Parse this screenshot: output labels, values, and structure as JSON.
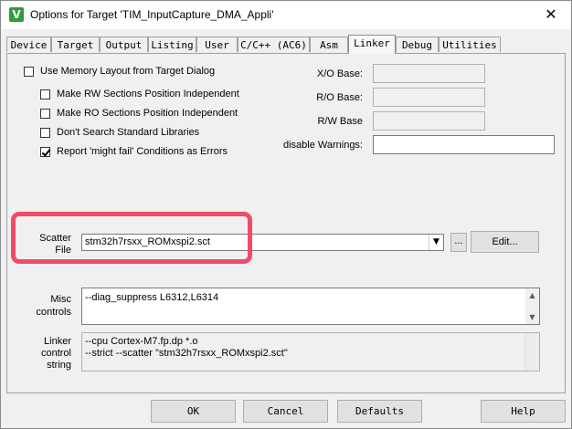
{
  "titlebar": {
    "icon_letter": "V",
    "title": "Options for Target 'TIM_InputCapture_DMA_Appli'",
    "close": "✕"
  },
  "tabs": [
    "Device",
    "Target",
    "Output",
    "Listing",
    "User",
    "C/C++ (AC6)",
    "Asm",
    "Linker",
    "Debug",
    "Utilities"
  ],
  "active_tab": "Linker",
  "options": {
    "use_memory_layout": "Use Memory Layout from Target Dialog",
    "rw_independent": "Make RW Sections Position Independent",
    "ro_independent": "Make RO Sections Position Independent",
    "dont_search_std": "Don't Search Standard Libraries",
    "might_fail_errors": "Report 'might fail' Conditions as Errors"
  },
  "bases": {
    "xo_label": "X/O Base:",
    "ro_label": "R/O Base:",
    "rw_label": "R/W Base",
    "warnings_label": "disable Warnings:"
  },
  "scatter": {
    "label_line1": "Scatter",
    "label_line2": "File",
    "value": "stm32h7rsxx_ROMxspi2.sct",
    "browse": "...",
    "edit": "Edit..."
  },
  "misc": {
    "label_line1": "Misc",
    "label_line2": "controls",
    "value": "--diag_suppress L6312,L6314"
  },
  "linker_string": {
    "label_line1": "Linker",
    "label_line2": "control",
    "label_line3": "string",
    "line1": "--cpu Cortex-M7.fp.dp *.o",
    "line2": "--strict --scatter \"stm32h7rsxx_ROMxspi2.sct\""
  },
  "footer": {
    "ok": "OK",
    "cancel": "Cancel",
    "defaults": "Defaults",
    "help": "Help"
  },
  "colors": {
    "highlight": "#f14a6a",
    "app_icon": "#2e9c3a"
  }
}
